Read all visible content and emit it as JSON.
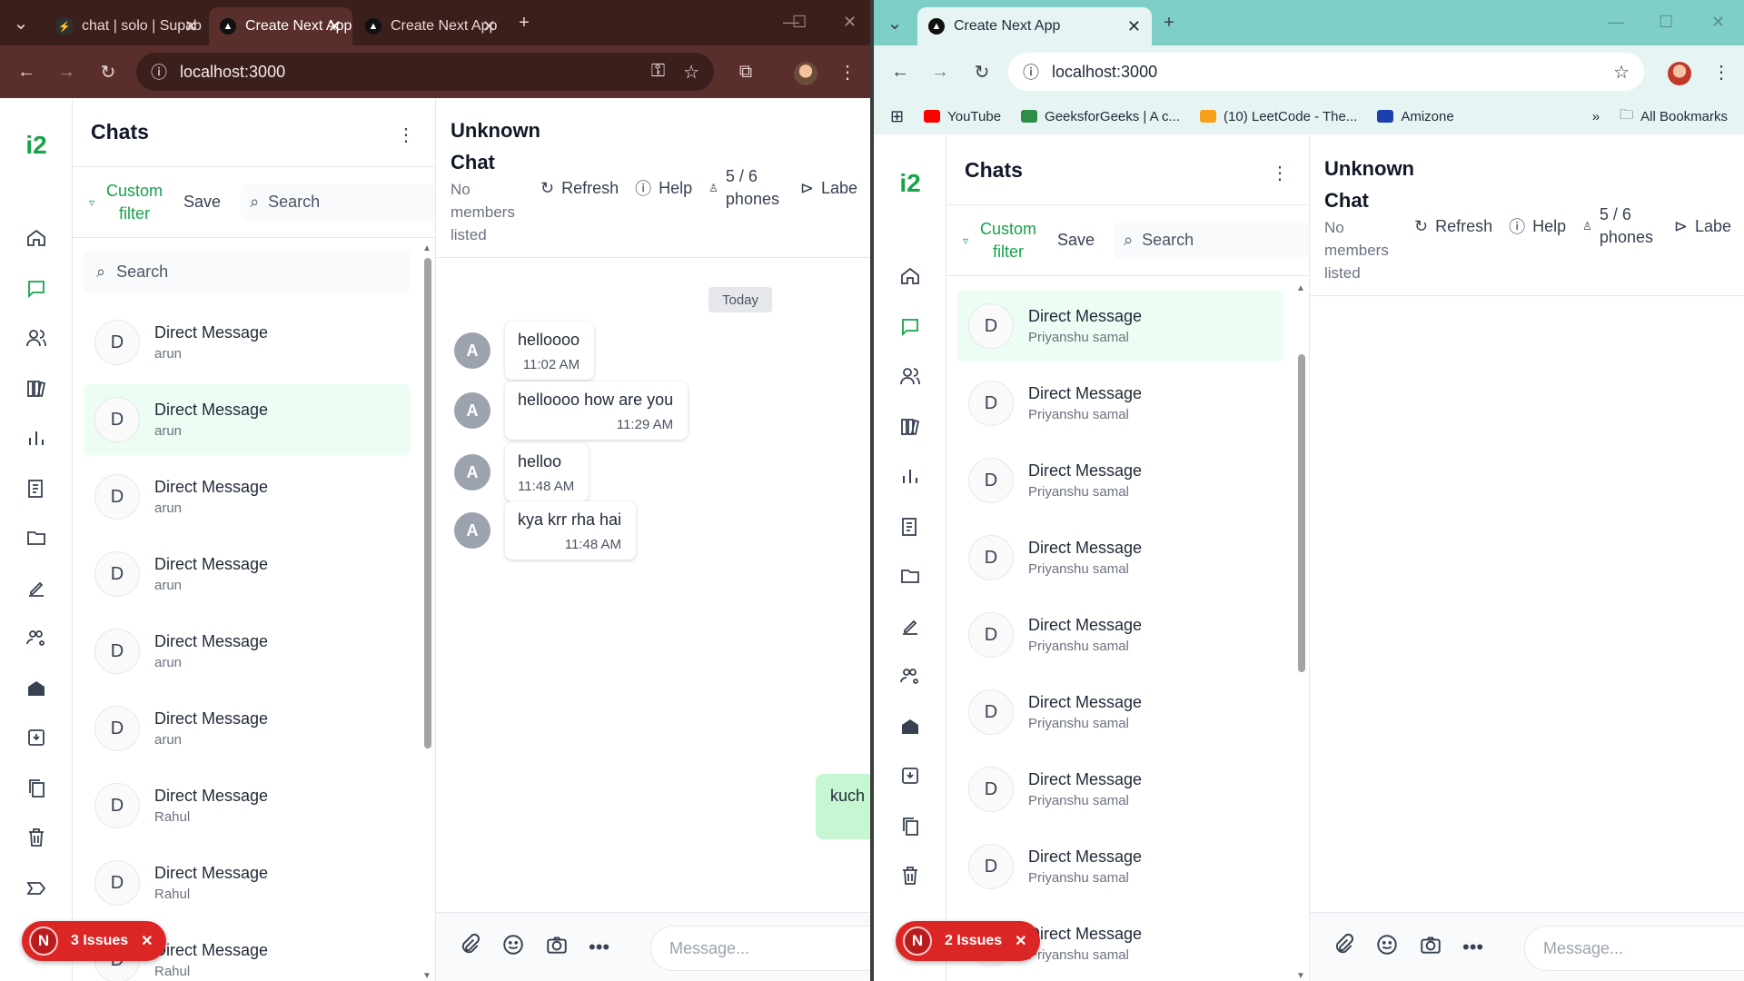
{
  "left_window": {
    "tabs": [
      {
        "title": "chat | solo | Supab",
        "favicon": "supabase-icon"
      },
      {
        "title": "Create Next App",
        "favicon": "nextjs-icon"
      },
      {
        "title": "Create Next App",
        "favicon": "nextjs-icon"
      }
    ],
    "url": "localhost:3000",
    "chats_title": "Chats",
    "custom_filter": "Custom filter",
    "save": "Save",
    "search_placeholder": "Search",
    "list_search_placeholder": "Search",
    "chat_items": [
      {
        "title": "Direct Message",
        "sub": "arun",
        "initial": "D",
        "active": false
      },
      {
        "title": "Direct Message",
        "sub": "arun",
        "initial": "D",
        "active": true
      },
      {
        "title": "Direct Message",
        "sub": "arun",
        "initial": "D",
        "active": false
      },
      {
        "title": "Direct Message",
        "sub": "arun",
        "initial": "D",
        "active": false
      },
      {
        "title": "Direct Message",
        "sub": "arun",
        "initial": "D",
        "active": false
      },
      {
        "title": "Direct Message",
        "sub": "arun",
        "initial": "D",
        "active": false
      },
      {
        "title": "Direct Message",
        "sub": "Rahul",
        "initial": "D",
        "active": false
      },
      {
        "title": "Direct Message",
        "sub": "Rahul",
        "initial": "D",
        "active": false
      },
      {
        "title": "Direct Message",
        "sub": "Rahul",
        "initial": "D",
        "active": false
      }
    ],
    "chat_header": {
      "title": "Unknown Chat",
      "members": "No members listed",
      "refresh": "Refresh",
      "help": "Help",
      "phones": "5 / 6 phones",
      "label": "Labe"
    },
    "today": "Today",
    "messages": [
      {
        "avatar": "A",
        "text": "helloooo",
        "time": "11:02 AM"
      },
      {
        "avatar": "A",
        "text": "helloooo how are you",
        "time": "11:29 AM"
      },
      {
        "avatar": "A",
        "text": "helloo",
        "time": "11:48 AM"
      },
      {
        "avatar": "A",
        "text": "kya krr rha hai",
        "time": "11:48 AM"
      }
    ],
    "outgoing": "kuch",
    "composer_placeholder": "Message...",
    "issues": "3 Issues",
    "logo": "i2"
  },
  "right_window": {
    "tabs": [
      {
        "title": "Create Next App",
        "favicon": "nextjs-icon"
      }
    ],
    "url": "localhost:3000",
    "bookmarks": [
      {
        "label": "YouTube",
        "color": "#ff0000"
      },
      {
        "label": "GeeksforGeeks | A c...",
        "color": "#2f8d46"
      },
      {
        "label": "(10) LeetCode - The...",
        "color": "#f89f1b"
      },
      {
        "label": "Amizone",
        "color": "#1e40af"
      }
    ],
    "all_bookmarks": "All Bookmarks",
    "chats_title": "Chats",
    "custom_filter": "Custom filter",
    "save": "Save",
    "search_placeholder": "Search",
    "chat_items": [
      {
        "title": "Direct Message",
        "sub": "Priyanshu samal",
        "initial": "D",
        "active": true
      },
      {
        "title": "Direct Message",
        "sub": "Priyanshu samal",
        "initial": "D",
        "active": false
      },
      {
        "title": "Direct Message",
        "sub": "Priyanshu samal",
        "initial": "D",
        "active": false
      },
      {
        "title": "Direct Message",
        "sub": "Priyanshu samal",
        "initial": "D",
        "active": false
      },
      {
        "title": "Direct Message",
        "sub": "Priyanshu samal",
        "initial": "D",
        "active": false
      },
      {
        "title": "Direct Message",
        "sub": "Priyanshu samal",
        "initial": "D",
        "active": false
      },
      {
        "title": "Direct Message",
        "sub": "Priyanshu samal",
        "initial": "D",
        "active": false
      },
      {
        "title": "Direct Message",
        "sub": "Priyanshu samal",
        "initial": "D",
        "active": false
      },
      {
        "title": "Direct Message",
        "sub": "Priyanshu samal",
        "initial": "D",
        "active": false
      }
    ],
    "chat_header": {
      "title": "Unknown Chat",
      "members": "No members listed",
      "refresh": "Refresh",
      "help": "Help",
      "phones": "5 / 6 phones",
      "label": "Labe"
    },
    "composer_placeholder": "Message...",
    "issues": "2 Issues",
    "logo": "i2"
  },
  "colors": {
    "accent": "#16a34a",
    "active_row": "#ecfdf3",
    "outgoing_bubble": "#c7f7d2",
    "issues_badge": "#dc2626",
    "left_frame": "#5a2e2a",
    "right_frame": "#7fcfc9"
  }
}
